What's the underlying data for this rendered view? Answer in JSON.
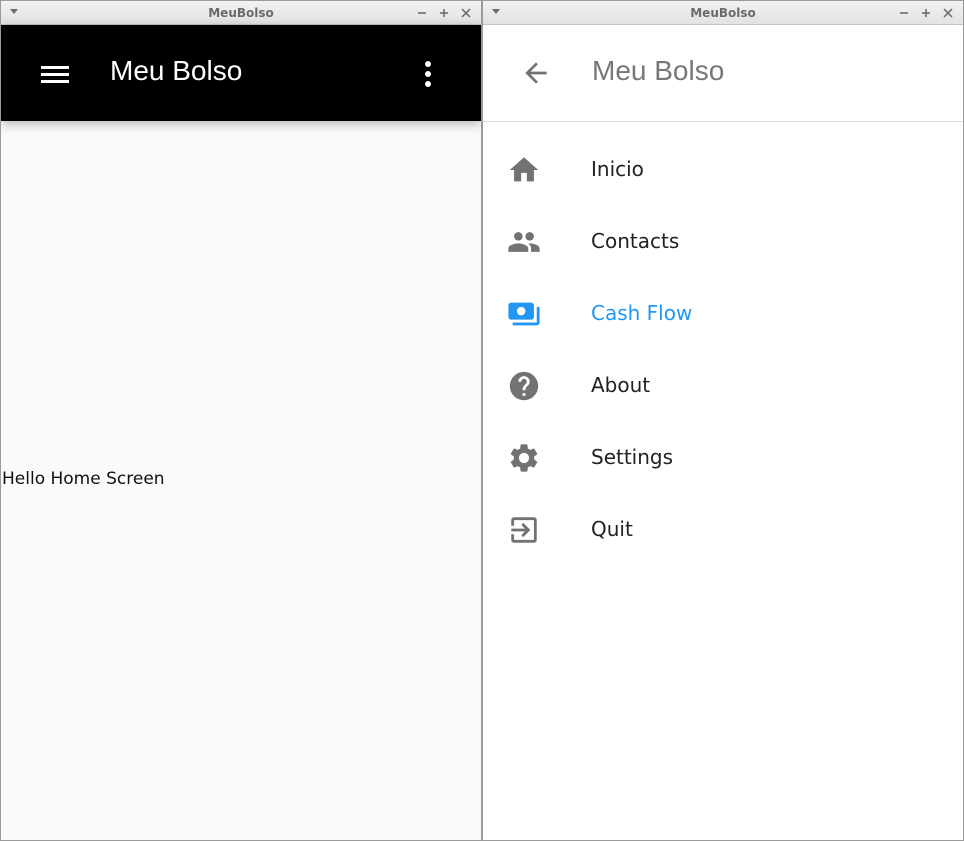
{
  "left_window": {
    "title": "MeuBolso",
    "appbar": {
      "title": "Meu Bolso",
      "menu_icon": "hamburger-menu-icon",
      "more_icon": "more-vert-icon"
    },
    "body_text": "Hello Home Screen"
  },
  "right_window": {
    "title": "MeuBolso",
    "drawer": {
      "title": "Meu Bolso",
      "back_icon": "arrow-back-icon",
      "items": [
        {
          "label": "Inicio",
          "icon": "home-icon"
        },
        {
          "label": "Contacts",
          "icon": "people-icon"
        },
        {
          "label": "Cash Flow",
          "icon": "money-icon",
          "active": true
        },
        {
          "label": "About",
          "icon": "help-icon"
        },
        {
          "label": "Settings",
          "icon": "gear-icon"
        },
        {
          "label": "Quit",
          "icon": "exit-icon"
        }
      ]
    }
  },
  "colors": {
    "appbar": "#000000",
    "accent": "#2196f3",
    "icon_gray": "#727272"
  }
}
